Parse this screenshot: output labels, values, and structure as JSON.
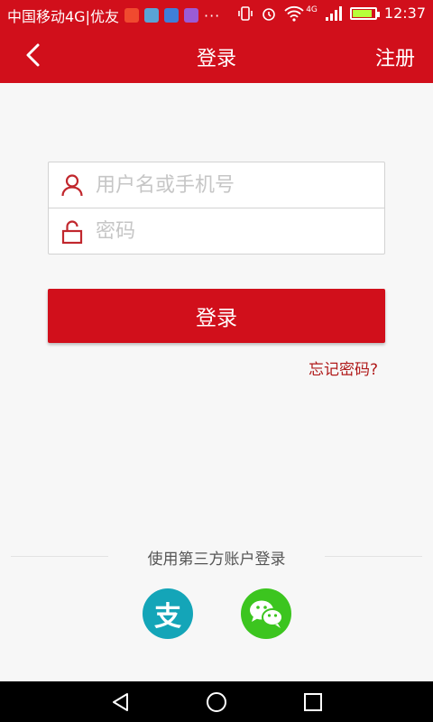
{
  "status_bar": {
    "carrier": "中国移动4G|优友",
    "dots": "···",
    "network": "4G",
    "time": "12:37",
    "battery_level": 0.9,
    "icons": [
      "notification-icon",
      "image-icon",
      "message-icon",
      "gallery-icon",
      "vibrate-icon",
      "alarm-icon",
      "wifi-icon",
      "signal-icon",
      "battery-icon"
    ]
  },
  "app_bar": {
    "back_icon": "chevron-left-icon",
    "title": "登录",
    "register_label": "注册"
  },
  "form": {
    "username": {
      "placeholder": "用户名或手机号",
      "value": "",
      "icon": "user-icon"
    },
    "password": {
      "placeholder": "密码",
      "value": "",
      "icon": "lock-icon"
    }
  },
  "login_button": "登录",
  "forgot_password": "忘记密码?",
  "third_party": {
    "label": "使用第三方账户登录",
    "providers": [
      {
        "name": "alipay-icon",
        "glyph": "支"
      },
      {
        "name": "wechat-icon"
      }
    ]
  },
  "colors": {
    "brand_red": "#d10f1b",
    "forgot_red": "#b01a1a",
    "alipay_blue": "#14a5b8",
    "wechat_green": "#3cc51f"
  },
  "nav_bar": {
    "icons": [
      "back-triangle-icon",
      "home-circle-icon",
      "recent-square-icon"
    ]
  }
}
